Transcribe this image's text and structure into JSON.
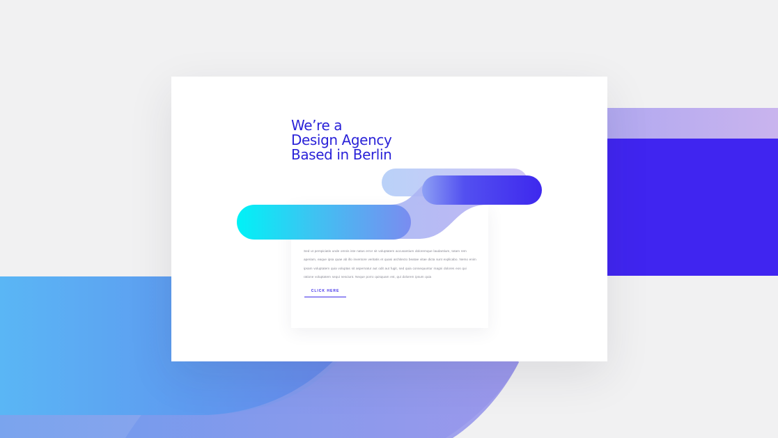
{
  "hero": {
    "headline_lines": [
      "We’re a",
      "Design Agency",
      "Based in Berlin"
    ]
  },
  "content": {
    "body": "Sed ut perspiciatis unde omnis iste natus error sit voluptatem accusantium doloremque laudantium, totam rem aperiam, eaque ipsa quae ab illo inventore veritatis et quasi architecto beatae vitae dicta sunt explicabo. Nemo enim ipsam voluptatem quia voluptas sit aspernatur aut odit aut fugit, sed quia consequuntur magni dolores eos qui ratione voluptatem sequi nesciunt. Neque porro quisquam est, qui dolorem ipsum quia",
    "cta_label": "CLICK HERE"
  },
  "colors": {
    "background": "#f1f1f2",
    "headline": "#2a22d8",
    "accent_blue": "#3b2ae8",
    "cyan": "#00f0f5",
    "lavender": "#c2b3ef",
    "light_blue": "#5ab4f4"
  }
}
